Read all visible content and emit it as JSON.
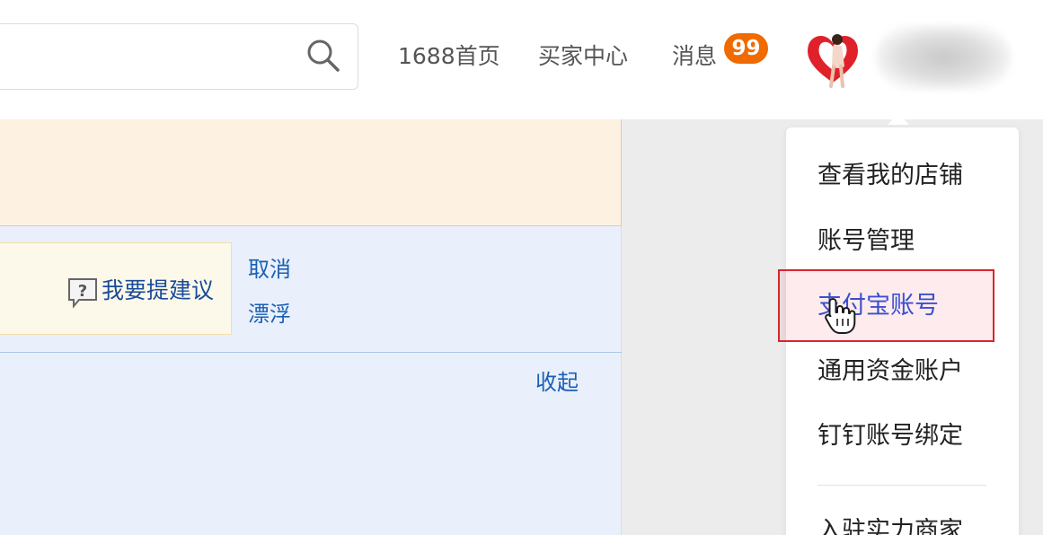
{
  "header": {
    "search": {
      "placeholder": ""
    },
    "nav": {
      "home_label": "1688首页",
      "buyer_center_label": "买家中心",
      "messages_label": "消息",
      "messages_badge": "99"
    }
  },
  "main": {
    "suggestion_label": "我要提建议",
    "cancel_label": "取消",
    "float_label": "漂浮",
    "collapse_label": "收起"
  },
  "dropdown": {
    "items": [
      {
        "label": "查看我的店铺"
      },
      {
        "label": "账号管理"
      },
      {
        "label": "支付宝账号"
      },
      {
        "label": "通用资金账户"
      },
      {
        "label": "钉钉账号绑定"
      },
      {
        "label": "入驻实力商家"
      }
    ],
    "highlighted_index": 2
  },
  "colors": {
    "badge": "#f06a00",
    "link": "#1a5fb4",
    "highlight_border": "#d9252e",
    "notice_bg": "#fdf1e2",
    "panel_bg": "#e9f0fb"
  }
}
